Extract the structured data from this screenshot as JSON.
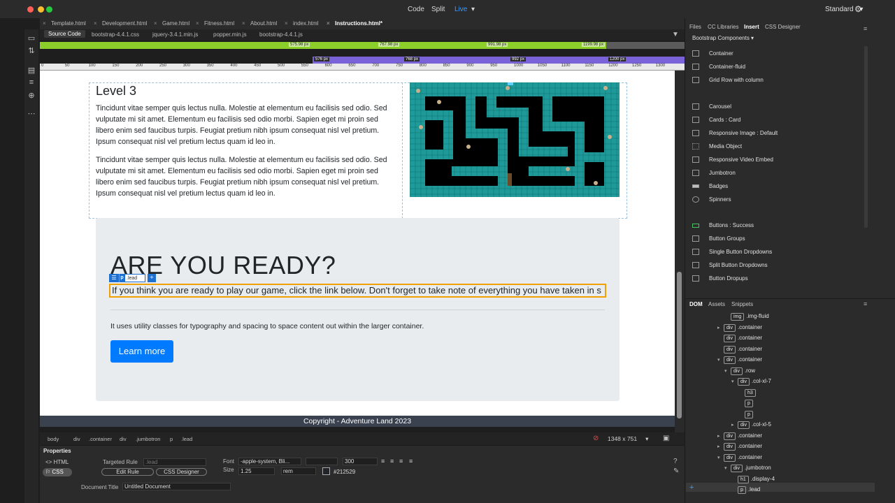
{
  "colors": {
    "live": "#3b9bff",
    "mq_green": "#8ccf2b",
    "mq_purple": "#7a63d8",
    "button": "#007bff",
    "jumbotron": "#e9ecef",
    "footer": "#3a4250",
    "lead_outline": "#f0a000"
  },
  "topbar": {
    "modes": [
      "Code",
      "Split",
      "Live"
    ],
    "live_caret": "▾",
    "workspace": "Standard",
    "workspace_caret": "▾",
    "settings_icon": "gear-icon"
  },
  "doc_tabs": [
    "Template.html",
    "Development.html",
    "Game.html",
    "Fitness.html",
    "About.html",
    "index.html",
    "Instructions.html*"
  ],
  "related_files": [
    "Source Code",
    "bootstrap-4.4.1.css",
    "jquery-3.4.1.min.js",
    "popper.min.js",
    "bootstrap-4.4.1.js"
  ],
  "media_queries": {
    "green": [
      "575.98 px",
      "767.98 px",
      "991.98 px",
      "1199.98 px"
    ],
    "purple": [
      "576 px",
      "768 px",
      "992 px",
      "1200 px"
    ]
  },
  "ruler_ticks": [
    "0",
    "50",
    "100",
    "150",
    "200",
    "250",
    "300",
    "350",
    "400",
    "450",
    "500",
    "550",
    "600",
    "650",
    "700",
    "750",
    "800",
    "850",
    "900",
    "950",
    "1000",
    "1050",
    "1100",
    "1150",
    "1200",
    "1250",
    "1300"
  ],
  "page": {
    "level_title": "Level 3",
    "para1": " Tincidunt vitae semper quis lectus nulla. Molestie at elementum eu facilisis sed odio. Sed vulputate mi sit amet. Elementum eu facilisis sed odio morbi. Sapien eget mi proin sed libero enim sed faucibus turpis. Feugiat pretium nibh ipsum consequat nisl vel pretium. Ipsum consequat nisl vel pretium lectus quam id leo in.",
    "para2": "Tincidunt vitae semper quis lectus nulla. Molestie at elementum eu facilisis sed odio. Sed vulputate mi sit amet. Elementum eu facilisis sed odio morbi. Sapien eget mi proin sed libero enim sed faucibus turpis. Feugiat pretium nibh ipsum consequat nisl vel pretium. Ipsum consequat nisl vel pretium lectus quam id leo in.",
    "heading": "ARE YOU READY?",
    "lead_tag": {
      "menu": "☰",
      "tag": "p",
      "class": ".lead",
      "add": "+"
    },
    "lead": "If you think you are ready to play our game, click the link below. Don't forget to take note of everything you have taken in s",
    "utility": "It uses utility classes for typography and spacing to space content out within the larger container.",
    "button": "Learn more",
    "footer": "Copyright - Adventure Land 2023"
  },
  "status": {
    "tags": [
      "body",
      "div",
      ".container",
      "div",
      ".jumbotron",
      "p",
      ".lead"
    ],
    "window_size": "1348 x 751",
    "window_caret": "▾"
  },
  "properties": {
    "title": "Properties",
    "html_toggle": "<> HTML",
    "css_toggle": "⚐ CSS",
    "targeted_rule_label": "Targeted Rule",
    "targeted_rule_value": ".lead",
    "edit_rule": "Edit Rule",
    "css_designer": "CSS Designer",
    "font_label": "Font",
    "font_value": "-apple-system, Bli...",
    "weight_value": "300",
    "size_label": "Size",
    "size_value": "1.25",
    "unit_value": "rem",
    "color_value": "#212529",
    "doc_title_label": "Document Title",
    "doc_title_value": "Untitled Document"
  },
  "right_panel": {
    "tabs": [
      "Files",
      "CC Libraries",
      "Insert",
      "CSS Designer"
    ],
    "category": "Bootstrap Components ▾",
    "insert_items": [
      "Container",
      "Container-fluid",
      "Grid Row with column",
      "Carousel",
      "Cards : Card",
      "Responsive Image : Default",
      "Media Object",
      "Responsive Video Embed",
      "Jumbotron",
      "Badges",
      "Spinners",
      "Buttons : Success",
      "Button Groups",
      "Single Button Dropdowns",
      "Split Button Dropdowns",
      "Button Dropups"
    ],
    "dom_tabs": [
      "DOM",
      "Assets",
      "Snippets"
    ],
    "dom_nodes": [
      {
        "tag": "img",
        "cls": ".img-fluid",
        "depth": 2,
        "arrow": ""
      },
      {
        "tag": "div",
        "cls": ".container",
        "depth": 1,
        "arrow": "▸"
      },
      {
        "tag": "div",
        "cls": ".container",
        "depth": 1,
        "arrow": ""
      },
      {
        "tag": "div",
        "cls": ".container",
        "depth": 1,
        "arrow": ""
      },
      {
        "tag": "div",
        "cls": ".container",
        "depth": 1,
        "arrow": "▾"
      },
      {
        "tag": "div",
        "cls": ".row",
        "depth": 2,
        "arrow": "▾"
      },
      {
        "tag": "div",
        "cls": ".col-xl-7",
        "depth": 3,
        "arrow": "▾"
      },
      {
        "tag": "h3",
        "cls": "",
        "depth": 4,
        "arrow": ""
      },
      {
        "tag": "p",
        "cls": "",
        "depth": 4,
        "arrow": ""
      },
      {
        "tag": "p",
        "cls": "",
        "depth": 4,
        "arrow": ""
      },
      {
        "tag": "div",
        "cls": ".col-xl-5",
        "depth": 3,
        "arrow": "▸"
      },
      {
        "tag": "div",
        "cls": ".container",
        "depth": 1,
        "arrow": "▸"
      },
      {
        "tag": "div",
        "cls": ".container",
        "depth": 1,
        "arrow": "▸"
      },
      {
        "tag": "div",
        "cls": ".container",
        "depth": 1,
        "arrow": "▾"
      },
      {
        "tag": "div",
        "cls": ".jumbotron",
        "depth": 2,
        "arrow": "▾"
      },
      {
        "tag": "h1",
        "cls": ".display-4",
        "depth": 3,
        "arrow": ""
      },
      {
        "tag": "p",
        "cls": ".lead",
        "depth": 3,
        "arrow": ""
      }
    ]
  }
}
